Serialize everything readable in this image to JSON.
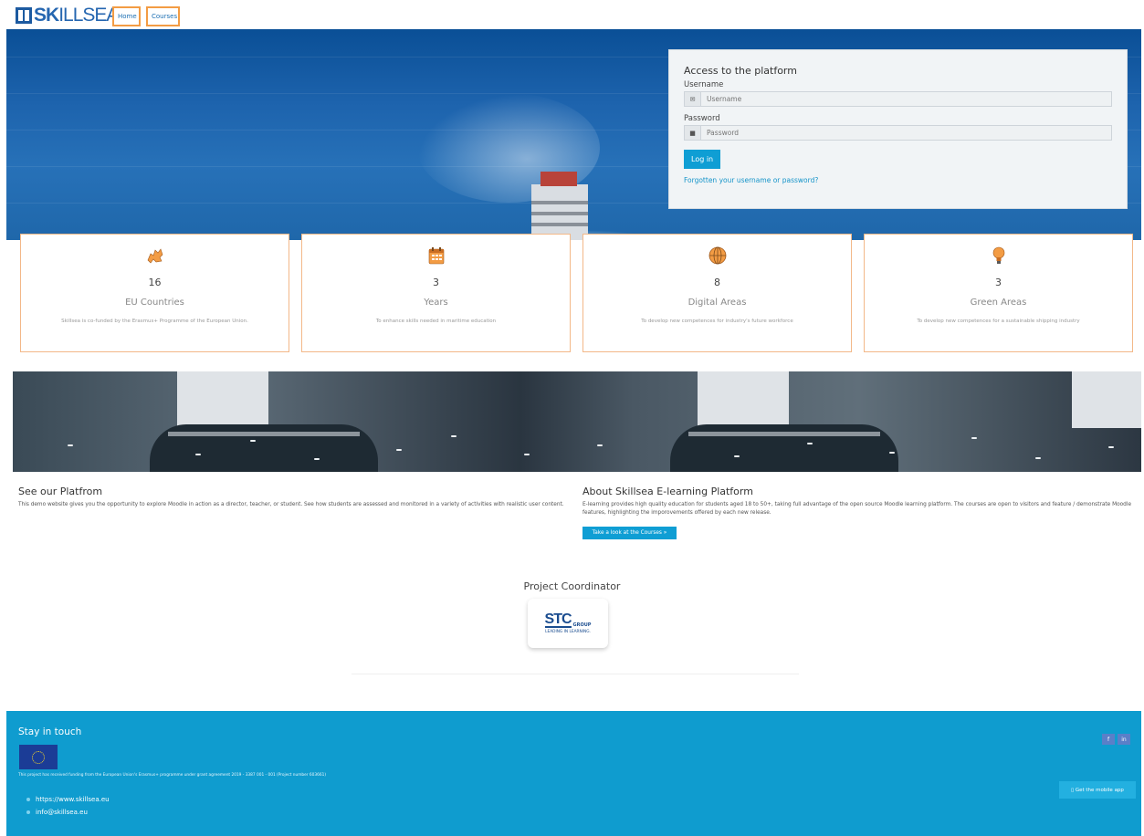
{
  "nav": {
    "logo_text_bold": "SK",
    "logo_text_rest": "ILLSEA",
    "home_label": "Home",
    "courses_label": "Courses"
  },
  "login": {
    "title": "Access to the platform",
    "username_label": "Username",
    "username_placeholder": "Username",
    "password_label": "Password",
    "password_placeholder": "Password",
    "login_button": "Log in",
    "forgot_link": "Forgotten your username or password?"
  },
  "stats": [
    {
      "icon": "europe-map-icon",
      "number": "16",
      "title": "EU Countries",
      "desc": "Skillsea is co-funded by the Erasmus+ Programme of the European Union."
    },
    {
      "icon": "calendar-icon",
      "number": "3",
      "title": "Years",
      "desc": "To enhance skills needed in maritime education"
    },
    {
      "icon": "globe-icon",
      "number": "8",
      "title": "Digital Areas",
      "desc": "To develop new competences for industry's future workforce"
    },
    {
      "icon": "lightbulb-icon",
      "number": "3",
      "title": "Green Areas",
      "desc": "To develop new competences for a sustainable shipping industry"
    }
  ],
  "platform": {
    "title": "See our Platfrom",
    "text": "This demo website gives you the opportunity to explore Moodle in action as a director, teacher, or student. See how students are assessed and monitored in a variety of activities with realistic user content."
  },
  "about": {
    "title": "About Skillsea E-learning Platform",
    "text": "E-learning provides high quality education for students aged 18 to 50+, taking full advantage of the open source Moodle learning platform. The courses are open to visitors and feature / demonstrate Moodle features, highlighting the imporovements offered by each new release.",
    "button": "Take a look at the Courses »"
  },
  "coordinator": {
    "title": "Project Coordinator",
    "logo_main": "STC",
    "logo_group": "GROUP",
    "logo_tagline": "LEADING IN LEARNING."
  },
  "footer": {
    "title": "Stay in touch",
    "funding": "This project has received funding from the European Union's Erasmus+ programme under grant agreement 2019 - 3387 001 - 001 (Project number 603661)",
    "website": "https://www.skillsea.eu",
    "email": "info@skillsea.eu",
    "social_1": "f",
    "social_2": "in",
    "mobile_app": "▯ Get the mobile app"
  },
  "colors": {
    "accent": "#0f9ed4",
    "card_border": "#f3b888",
    "footer_bg": "#0f9ccf",
    "nav_border": "#f39c44"
  }
}
